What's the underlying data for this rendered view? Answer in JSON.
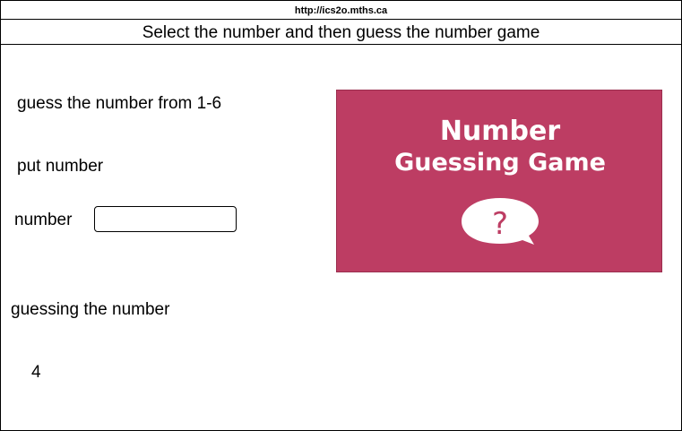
{
  "window": {
    "url": "http://ics2o.mths.ca"
  },
  "page": {
    "title": "Select the number and then guess the number game"
  },
  "main": {
    "instruction": "guess the number from 1-6",
    "put_label": "put number",
    "number_label": "number",
    "number_input_value": "",
    "guessing_label": "guessing the number",
    "result_value": "4"
  },
  "image": {
    "line1": "Number",
    "line2": "Guessing Game",
    "symbol": "?",
    "icon": "speech-bubble-question-icon"
  },
  "colors": {
    "image_background": "#bd3d63",
    "image_text": "#ffffff"
  }
}
